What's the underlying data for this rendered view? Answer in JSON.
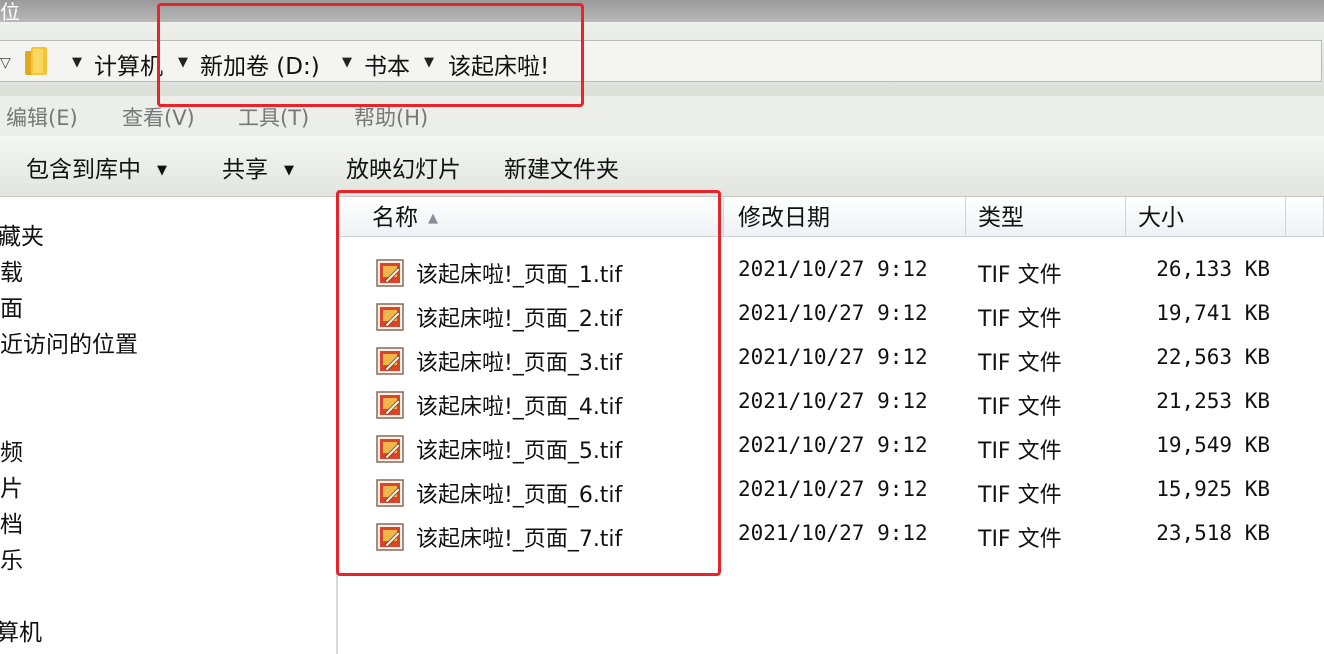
{
  "window": {
    "title_fragment": "位"
  },
  "address_bar": {
    "path": [
      "计算机",
      "新加卷 (D:)",
      "书本",
      "该起床啦!"
    ]
  },
  "menu": [
    "编辑(E)",
    "查看(V)",
    "工具(T)",
    "帮助(H)"
  ],
  "toolbar": {
    "include_library": "包含到库中",
    "share": "共享",
    "slideshow": "放映幻灯片",
    "new_folder": "新建文件夹"
  },
  "nav_pane": {
    "items": [
      "藏夹",
      "载",
      "面",
      "近访问的位置",
      "频",
      "片",
      "档",
      "乐",
      "算机"
    ]
  },
  "columns": {
    "name": "名称",
    "modified": "修改日期",
    "type": "类型",
    "size": "大小"
  },
  "files": [
    {
      "name": "该起床啦!_页面_1.tif",
      "modified": "2021/10/27 9:12",
      "type": "TIF 文件",
      "size": "26,133 KB"
    },
    {
      "name": "该起床啦!_页面_2.tif",
      "modified": "2021/10/27 9:12",
      "type": "TIF 文件",
      "size": "19,741 KB"
    },
    {
      "name": "该起床啦!_页面_3.tif",
      "modified": "2021/10/27 9:12",
      "type": "TIF 文件",
      "size": "22,563 KB"
    },
    {
      "name": "该起床啦!_页面_4.tif",
      "modified": "2021/10/27 9:12",
      "type": "TIF 文件",
      "size": "21,253 KB"
    },
    {
      "name": "该起床啦!_页面_5.tif",
      "modified": "2021/10/27 9:12",
      "type": "TIF 文件",
      "size": "19,549 KB"
    },
    {
      "name": "该起床啦!_页面_6.tif",
      "modified": "2021/10/27 9:12",
      "type": "TIF 文件",
      "size": "15,925 KB"
    },
    {
      "name": "该起床啦!_页面_7.tif",
      "modified": "2021/10/27 9:12",
      "type": "TIF 文件",
      "size": "23,518 KB"
    }
  ],
  "icons": {
    "folder": "folder-icon",
    "file": "tif-image-file-icon",
    "sort": "sort-ascending-icon"
  },
  "colors": {
    "highlight": "#e8232a"
  }
}
